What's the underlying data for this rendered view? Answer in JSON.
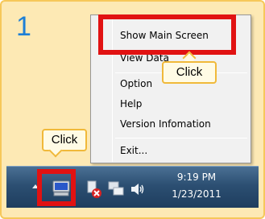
{
  "step": {
    "number": "1"
  },
  "context_menu": {
    "items": [
      {
        "label": "Show Main Screen"
      },
      {
        "label": "View Data"
      },
      {
        "label": "Option"
      },
      {
        "label": "Help"
      },
      {
        "label": "Version Infomation"
      },
      {
        "label": "Exit..."
      }
    ]
  },
  "callouts": {
    "menu_click": "Click",
    "tray_click": "Click"
  },
  "taskbar": {
    "clock_time": "9:19 PM",
    "clock_date": "1/23/2011",
    "tray_icons": [
      "app-monitor-icon",
      "network-error-icon",
      "network-icon",
      "volume-icon"
    ]
  },
  "colors": {
    "highlight": "#e11212",
    "step_number": "#1d7fd6",
    "frame_background": "#fde9b4",
    "callout_border": "#f0b93a"
  }
}
